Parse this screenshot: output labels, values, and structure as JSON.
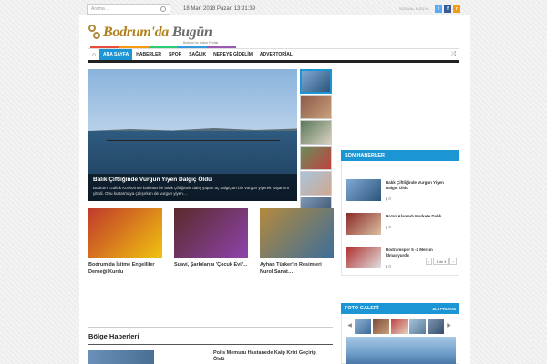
{
  "topbar": {
    "search_placeholder": "Arama ...",
    "datetime": "18 Mart 2018 Pazar, 13:31:39",
    "follow_label": "SOSYAL MEDYA",
    "social": [
      {
        "name": "twitter-icon",
        "glyph": "t",
        "color": "#55acee"
      },
      {
        "name": "facebook-icon",
        "glyph": "f",
        "color": "#3b5998"
      },
      {
        "name": "rss-icon",
        "glyph": "r",
        "color": "#f39c12"
      }
    ]
  },
  "logo": {
    "title_a": "Bodrum'da",
    "title_b": "Bugün",
    "subtitle": "Bodrum'un Haber Portalı"
  },
  "nav": {
    "items": [
      "ANA SAYFA",
      "HABERLER",
      "SPOR",
      "SAĞLIK",
      "NEREYE GİDELİM",
      "ADVERTORİAL"
    ],
    "active_index": 0,
    "stripe_colors": [
      "#e74c3c",
      "#f39c12",
      "#2ecc71",
      "#3498db",
      "#9b59b6"
    ]
  },
  "hero": {
    "title": "Balık Çiftliğinde Vurgun Yiyen Dalgıç Öldü",
    "summary": "Bodrum, Güllük Körfezinde bulunan bir balık çiftliğinde dalış yapan üç dalgıçtan biri vurgun yiyerek yaşamını yitirdi. Onu kurtarmaya çalışırken de vurgun yiyen…"
  },
  "thumbs": [
    {
      "colors": [
        "#7fa9d4",
        "#2c557a"
      ]
    },
    {
      "colors": [
        "#8c5a4a",
        "#c9a07a"
      ]
    },
    {
      "colors": [
        "#5a7a5a",
        "#d9d0c0"
      ]
    },
    {
      "colors": [
        "#6a8f5a",
        "#c04040"
      ]
    },
    {
      "colors": [
        "#a8c4dd",
        "#d0a890"
      ]
    },
    {
      "colors": [
        "#7f98b5",
        "#354d6a"
      ]
    }
  ],
  "cards": [
    {
      "title": "Bodrum'da İşitme Engelliler Derneği Kurdu",
      "colors": [
        "#c0392b",
        "#f1c40f"
      ]
    },
    {
      "title": "Suavi, Şarkılarını 'Çocuk Evi'…",
      "colors": [
        "#5a2a2a",
        "#8e44ad"
      ]
    },
    {
      "title": "Ayhan Türker'in Resimleri Nurol Sanat…",
      "colors": [
        "#b48a3c",
        "#3c6e9a"
      ]
    }
  ],
  "bolge": {
    "heading": "Bölge Haberleri",
    "first_title": "Polis Memuru Hastanede Kalp Krizi Geçirip Öldü"
  },
  "son_haberler": {
    "heading": "SON HABERLER",
    "items": [
      {
        "title": "Balık Çiftliğinde Vurgun Yiyen Dalgıç Öldü",
        "comments": "0",
        "colors": [
          "#7fa9d4",
          "#2c557a"
        ]
      },
      {
        "title": "Hazırı Alamadı Markete Daldı",
        "comments": "0",
        "colors": [
          "#8c2a2a",
          "#d9c0a0"
        ]
      },
      {
        "title": "Bodrumspor 5 -2 Mersin İdmanyurdu",
        "comments": "0",
        "colors": [
          "#b03030",
          "#e0e0e0"
        ]
      }
    ],
    "pager_label": "1 de 4"
  },
  "gallery": {
    "heading": "FOTO GALERİ",
    "all_label": "ALL PHOTOS",
    "thumbs": [
      {
        "colors": [
          "#8fb3d8",
          "#3e6a95"
        ]
      },
      {
        "colors": [
          "#7a4a3a",
          "#c9a07a"
        ]
      },
      {
        "colors": [
          "#c04040",
          "#e0d0c0"
        ]
      },
      {
        "colors": [
          "#a8c4dd",
          "#5a7a9a"
        ]
      },
      {
        "colors": [
          "#7f98b5",
          "#354d6a"
        ]
      }
    ]
  }
}
